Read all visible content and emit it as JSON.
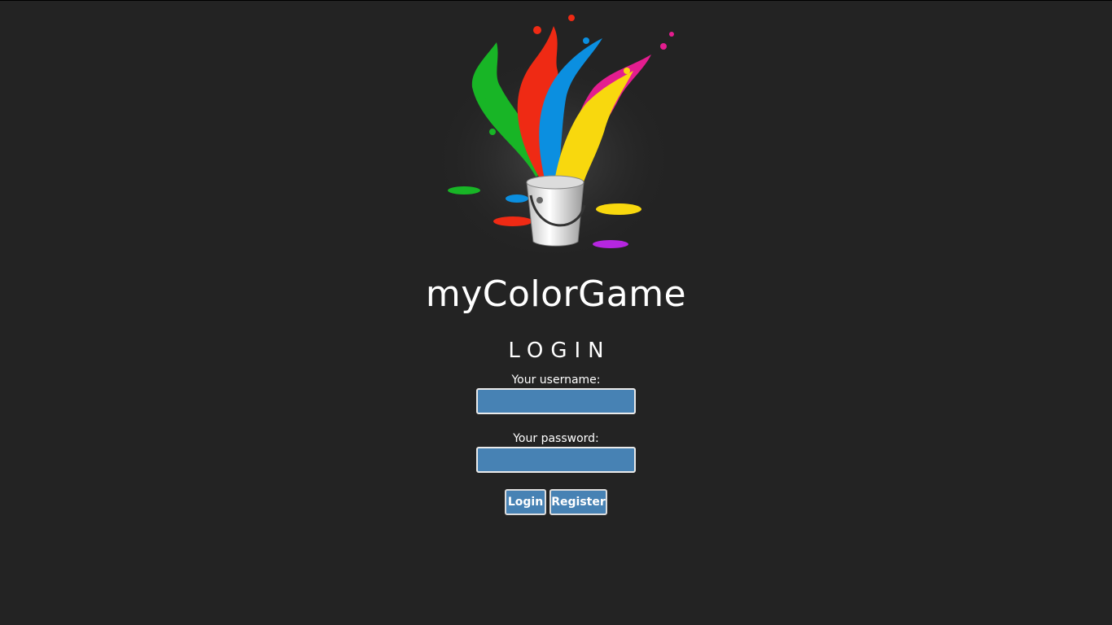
{
  "app": {
    "title": "myColorGame",
    "logo_icon": "paint-bucket-splash-icon"
  },
  "login": {
    "heading": "LOGIN",
    "username_label": "Your username:",
    "username_value": "",
    "password_label": "Your password:",
    "password_value": "",
    "login_button": "Login",
    "register_button": "Register"
  },
  "colors": {
    "background": "#232323",
    "field_fill": "#4782b4",
    "text": "#ffffff"
  }
}
